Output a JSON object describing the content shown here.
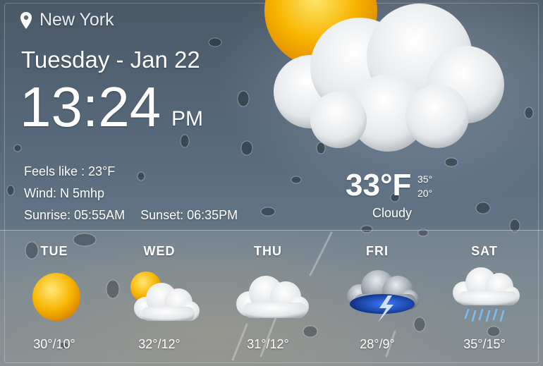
{
  "location": {
    "name": "New York",
    "icon": "location-pin-icon"
  },
  "date": "Tuesday - Jan 22",
  "time": {
    "clock": "13:24",
    "ampm": "PM"
  },
  "details": {
    "feels_like": "Feels like : 23°F",
    "wind": "Wind: N 5mhp",
    "sunrise": "Sunrise: 05:55AM",
    "sunset": "Sunset: 06:35PM"
  },
  "current": {
    "temp": "33°F",
    "high": "35°",
    "low": "20°",
    "condition": "Cloudy",
    "icon": "sun-behind-cloud-icon"
  },
  "forecast": [
    {
      "day": "TUE",
      "temps": "30°/10°",
      "icon": "sun-icon"
    },
    {
      "day": "WED",
      "temps": "32°/12°",
      "icon": "partly-cloudy-icon"
    },
    {
      "day": "THU",
      "temps": "31°/12°",
      "icon": "cloud-icon"
    },
    {
      "day": "FRI",
      "temps": "28°/9°",
      "icon": "thunderstorm-icon"
    },
    {
      "day": "SAT",
      "temps": "35°/15°",
      "icon": "rain-cloud-icon"
    }
  ],
  "colors": {
    "text": "#ffffff",
    "sun": "#f7b500",
    "storm": "#1e4fb0"
  }
}
